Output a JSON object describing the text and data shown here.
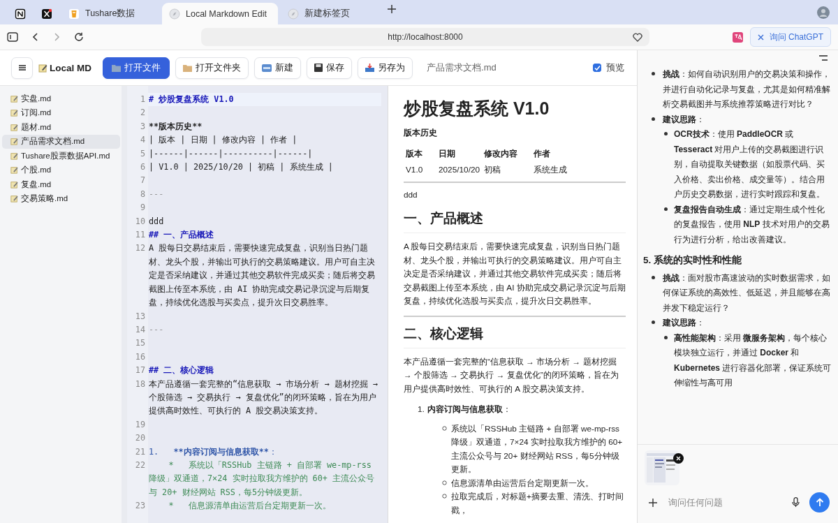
{
  "browser": {
    "tabs": [
      {
        "kind": "pinned",
        "selected": false
      },
      {
        "kind": "pinned",
        "selected": false
      },
      {
        "kind": "page",
        "label": "Tushare数据",
        "selected": false
      },
      {
        "kind": "page",
        "label": "Local Markdown Edit",
        "selected": true
      },
      {
        "kind": "page",
        "label": "新建标签页",
        "selected": false
      }
    ],
    "url": "http://localhost:8000",
    "chatgpt_button": "询问 ChatGPT"
  },
  "app": {
    "title": "Local MD",
    "buttons": [
      {
        "label": "打开文件",
        "primary": true
      },
      {
        "label": "打开文件夹",
        "primary": false
      },
      {
        "label": "新建",
        "primary": false
      },
      {
        "label": "保存",
        "primary": false
      },
      {
        "label": "另存为",
        "primary": false
      }
    ],
    "filename": "产品需求文档.md",
    "preview": {
      "label": "预览",
      "checked": true
    }
  },
  "files": [
    {
      "name": "实盘.md",
      "selected": false
    },
    {
      "name": "订阅.md",
      "selected": false
    },
    {
      "name": "题材.md",
      "selected": false
    },
    {
      "name": "产品需求文档.md",
      "selected": true
    },
    {
      "name": "Tushare股票数据API.md",
      "selected": false
    },
    {
      "name": "个股.md",
      "selected": false
    },
    {
      "name": "复盘.md",
      "selected": false
    },
    {
      "name": "交易策略.md",
      "selected": false
    }
  ],
  "editor": {
    "lines": [
      {
        "number": "1",
        "kind": "h1",
        "text": "# 炒股复盘系统 V1.0",
        "current": true
      },
      {
        "number": "2",
        "kind": "blank",
        "current": false
      },
      {
        "number": "3",
        "kind": "bold",
        "text": "**版本历史**",
        "current": false
      },
      {
        "number": "4",
        "kind": "plain",
        "text": "| 版本 | 日期 | 修改内容 | 作者 |",
        "current": false
      },
      {
        "number": "5",
        "kind": "plain",
        "text": "|------|------|----------|------|",
        "current": false
      },
      {
        "number": "6",
        "kind": "plain",
        "text": "| V1.0 | 2025/10/20 | 初稿 | 系统生成 |",
        "current": false
      },
      {
        "number": "7",
        "kind": "blank",
        "current": false
      },
      {
        "number": "8",
        "kind": "hr",
        "text": "---",
        "current": false
      },
      {
        "number": "9",
        "kind": "blank",
        "current": false
      },
      {
        "number": "10",
        "kind": "plain",
        "text": "ddd",
        "current": false
      },
      {
        "number": "11",
        "kind": "h2",
        "text": "## 一、产品概述",
        "current": false
      },
      {
        "number": "12",
        "kind": "plain",
        "text": "A 股每日交易结束后，需要快速完成复盘，识别当日热门题材、龙头个股，并输出可执行的交易策略建议。用户可自主决定是否采纳建议，并通过其他交易软件完成买卖；随后将交易截图上传至本系统，由 AI 协助完成交易记录沉淀与后期复盘，持续优化选股与买卖点，提升次日交易胜率。",
        "current": false
      },
      {
        "number": "13",
        "kind": "blank",
        "current": false
      },
      {
        "number": "14",
        "kind": "hr",
        "text": "---",
        "current": false
      },
      {
        "number": "15",
        "kind": "blank",
        "current": false
      },
      {
        "number": "16",
        "kind": "blank",
        "current": false
      },
      {
        "number": "17",
        "kind": "h2",
        "text": "## 二、核心逻辑",
        "current": false
      },
      {
        "number": "18",
        "kind": "plain",
        "text": "本产品遵循一套完整的“信息获取 → 市场分析 → 题材挖掘 → 个股筛选 → 交易执行 → 复盘优化”的闭环策略，旨在为用户提供高时效性、可执行的 A 股交易决策支持。",
        "current": false
      },
      {
        "number": "19",
        "kind": "blank",
        "current": false
      },
      {
        "number": "20",
        "kind": "blank",
        "current": false
      },
      {
        "number": "21",
        "kind": "list",
        "parts": [
          {
            "text": "1.   ",
            "bold": false
          },
          {
            "text": "**内容订阅与信息获取**",
            "bold": true
          },
          {
            "text": "：",
            "bold": false
          }
        ],
        "current": false
      },
      {
        "number": "22",
        "kind": "sublist",
        "text": "    *   系统以「RSSHub 主链路 + 自部署 we-mp-rss 降级」双通道，7×24 实时拉取我方维护的 60+ 主流公众号与 20+ 财经网站 RSS，每5分钟级更新。",
        "current": false
      },
      {
        "number": "23",
        "kind": "sublist",
        "text": "    *   信息源清单由运营后台定期更新一次。",
        "current": false
      }
    ]
  },
  "preview": {
    "blocks": [
      {
        "kind": "h1",
        "text": "炒股复盘系统 V1.0"
      },
      {
        "kind": "strong",
        "text": "版本历史"
      },
      {
        "kind": "table",
        "header": [
          "版本",
          "日期",
          "修改内容",
          "作者"
        ],
        "rows": [
          [
            "V1.0",
            "2025/10/20",
            "初稿",
            "系统生成"
          ]
        ]
      },
      {
        "kind": "hr"
      },
      {
        "kind": "para",
        "text": "ddd"
      },
      {
        "kind": "h2",
        "text": "一、产品概述"
      },
      {
        "kind": "para",
        "text": "A 股每日交易结束后，需要快速完成复盘，识别当日热门题材、龙头个股，并输出可执行的交易策略建议。用户可自主决定是否采纳建议，并通过其他交易软件完成买卖；随后将交易截图上传至本系统，由 AI 协助完成交易记录沉淀与后期复盘，持续优化选股与买卖点，提升次日交易胜率。"
      },
      {
        "kind": "hr"
      },
      {
        "kind": "h2",
        "text": "二、核心逻辑"
      },
      {
        "kind": "para",
        "text": "本产品遵循一套完整的“信息获取 → 市场分析 → 题材挖掘 → 个股筛选 → 交易执行 → 复盘优化”的闭环策略，旨在为用户提供高时效性、可执行的 A 股交易决策支持。"
      },
      {
        "kind": "ol",
        "items": [
          {
            "number": "1.",
            "text": "**内容订阅与信息获取**：",
            "children": [
              {
                "text": "系统以「RSSHub 主链路 + 自部署 we-mp-rss 降级」双通道，7×24 实时拉取我方维护的 60+ 主流公众号与 20+ 财经网站 RSS，每5分钟级更新。"
              },
              {
                "text": "信息源清单由运营后台定期更新一次。"
              },
              {
                "text": "拉取完成后，对标题+摘要去重、清洗、打时间戳，"
              }
            ]
          }
        ]
      }
    ]
  },
  "chat": {
    "blocks": [
      {
        "kind": "bullet",
        "text": "**挑战**：如何自动识别用户的交易决策和操作，并进行自动化记录与复盘，尤其是如何精准解析交易截图并与系统推荐策略进行对比？"
      },
      {
        "kind": "bullet",
        "text": "**建议思路**：",
        "children": [
          {
            "text": "**OCR技术**：使用 **PaddleOCR** 或 **Tesseract** 对用户上传的交易截图进行识别，自动提取关键数据（如股票代码、买入价格、卖出价格、成交量等）。结合用户历史交易数据，进行实时跟踪和复盘。"
          },
          {
            "text": "**复盘报告自动生成**：通过定期生成个性化的复盘报告，使用 **NLP** 技术对用户的交易行为进行分析，给出改善建议。"
          }
        ]
      },
      {
        "kind": "heading",
        "text": "5. 系统的实时性和性能"
      },
      {
        "kind": "bullet",
        "text": "**挑战**：面对股市高速波动的实时数据需求，如何保证系统的高效性、低延迟，并且能够在高并发下稳定运行？"
      },
      {
        "kind": "bullet",
        "text": "**建议思路**：",
        "children": [
          {
            "text": "**高性能架构**：采用 **微服务架构**，每个核心模块独立运行，并通过 **Docker** 和 **Kubernetes** 进行容器化部署，保证系统可伸缩性与高可用"
          }
        ]
      }
    ],
    "placeholder": "询问任何问题"
  }
}
